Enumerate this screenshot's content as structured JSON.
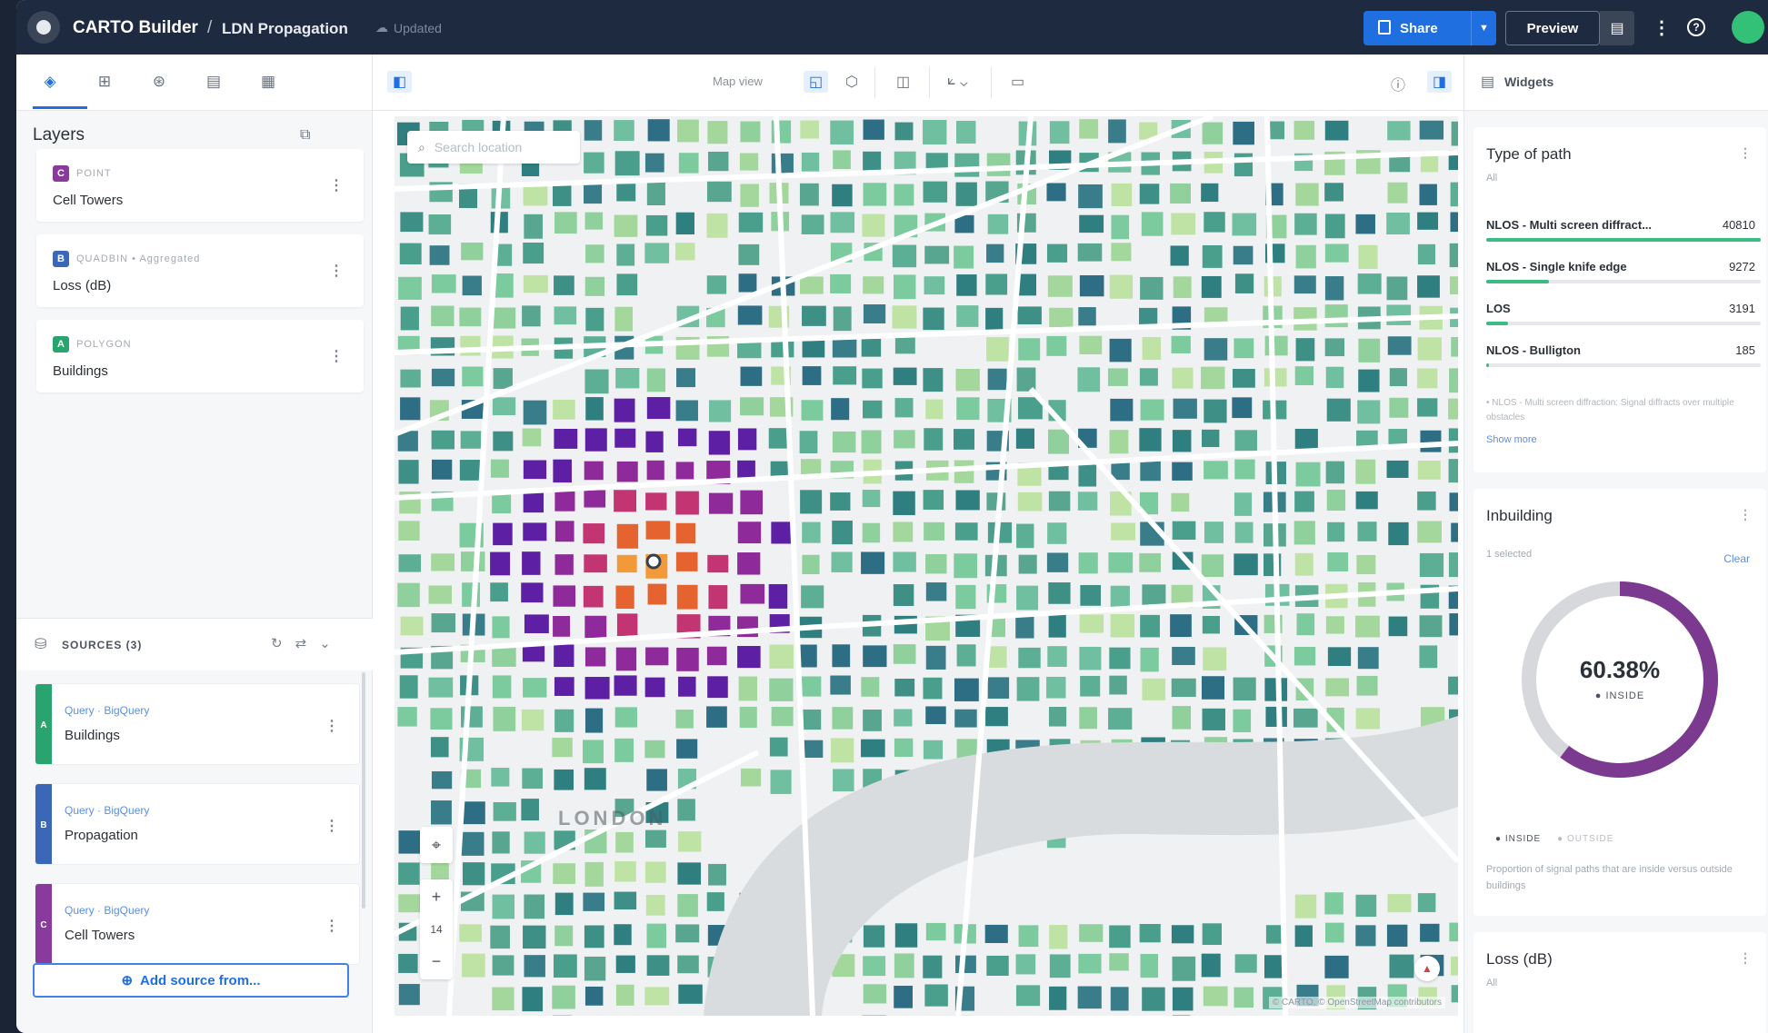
{
  "header": {
    "app_title": "CARTO Builder",
    "separator": "/",
    "map_title": "LDN Propagation",
    "status": "Updated",
    "share_label": "Share",
    "preview_label": "Preview"
  },
  "left_panel": {
    "tabs": [
      "layers-tab",
      "sources-tab",
      "analysis-tab",
      "widgets-tab",
      "interactions-tab"
    ],
    "layers_title": "Layers",
    "layers": [
      {
        "badge": "C",
        "type": "POINT",
        "name": "Cell Towers",
        "color": "#8a3a9c"
      },
      {
        "badge": "B",
        "type": "QUADBIN • Aggregated",
        "name": "Loss (dB)",
        "color": "#3a67b8"
      },
      {
        "badge": "A",
        "type": "POLYGON",
        "name": "Buildings",
        "color": "#2aa46e"
      }
    ],
    "sources_title": "SOURCES (3)",
    "sources": [
      {
        "letter": "A",
        "type": "Query · BigQuery",
        "name": "Buildings",
        "color": "#2aa46e"
      },
      {
        "letter": "B",
        "type": "Query · BigQuery",
        "name": "Propagation",
        "color": "#3a67b8"
      },
      {
        "letter": "C",
        "type": "Query · BigQuery",
        "name": "Cell Towers",
        "color": "#8a3a9c"
      }
    ],
    "add_source_label": "Add source from..."
  },
  "toolbar": {
    "map_view_label": "Map view"
  },
  "map": {
    "search_placeholder": "Search location",
    "zoom_level": "14",
    "city_label": "LONDON",
    "attribution": "© CARTO, © OpenStreetMap contributors"
  },
  "widgets": {
    "panel_label": "Widgets",
    "type_of_path": {
      "title": "Type of path",
      "subtitle": "All",
      "rows": [
        {
          "name": "NLOS - Multi screen diffract...",
          "value": "40810",
          "fraction": 1.0
        },
        {
          "name": "NLOS - Single knife edge",
          "value": "9272",
          "fraction": 0.23
        },
        {
          "name": "LOS",
          "value": "3191",
          "fraction": 0.08
        },
        {
          "name": "NLOS - Bulligton",
          "value": "185",
          "fraction": 0.01
        }
      ],
      "note": "•  NLOS - Multi screen diffraction: Signal diffracts over multiple obstacles",
      "show_more": "Show more"
    },
    "inbuilding": {
      "title": "Inbuilding",
      "subtitle": "1 selected",
      "clear": "Clear",
      "percent_text": "60.38%",
      "center_label": "INSIDE",
      "fraction": 0.6038,
      "legend": [
        "INSIDE",
        "OUTSIDE"
      ],
      "description": "Proportion of signal paths that are inside versus outside buildings",
      "color_main": "#7b3a8f",
      "color_rest": "#d6d8dc"
    },
    "loss": {
      "title": "Loss (dB)",
      "subtitle": "All"
    }
  }
}
